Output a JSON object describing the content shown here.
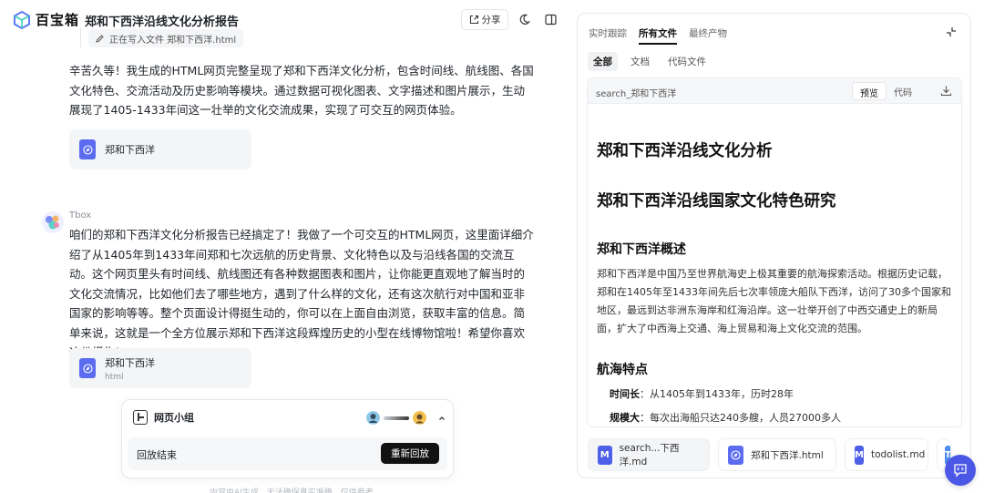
{
  "app": {
    "name": "百宝箱",
    "doc_title": "郑和下西洋沿线文化分析报告"
  },
  "header": {
    "share_label": "分享"
  },
  "chat": {
    "writing_chip": "正在写入文件  郑和下西洋.html",
    "msg1": "辛苦久等！我生成的HTML网页完整呈现了郑和下西洋文化分析，包含时间线、航线图、各国文化特色、交流活动及历史影响等模块。通过数据可视化图表、文字描述和图片展示，生动展现了1405-1433年间这一壮举的文化交流成果，实现了可交互的网页体验。",
    "card1_name": "郑和下西洋",
    "sender": "Tbox",
    "msg2": "咱们的郑和下西洋文化分析报告已经搞定了！我做了一个可交互的HTML网页，这里面详细介绍了从1405年到1433年间郑和七次远航的历史背景、文化特色以及与沿线各国的交流互动。这个网页里头有时间线、航线图还有各种数据图表和图片，让你能更直观地了解当时的文化交流情况，比如他们去了哪些地方，遇到了什么样的文化，还有这次航行对中国和亚非国家的影响等等。整个页面设计得挺生动的，你可以在上面自由浏览，获取丰富的信息。简单来说，这就是一个全方位展示郑和下西洋这段辉煌历史的小型在线博物馆啦！希望你喜欢这份报告！",
    "card2_name": "郑和下西洋",
    "card2_sub": "html"
  },
  "replay": {
    "group_label": "网页小组",
    "status": "回放结束",
    "replay_button": "重新回放",
    "progress": 1.0
  },
  "disclaimer": "内容由AI生成，无法确保真实准确，仅供参考",
  "panel": {
    "tabs": [
      "实时跟踪",
      "所有文件",
      "最终产物"
    ],
    "active_tab": "所有文件",
    "subtabs": [
      "全部",
      "文档",
      "代码文件"
    ],
    "active_subtab": "全部",
    "viewer_name": "search_郑和下西洋",
    "view_modes": [
      "预览",
      "代码"
    ],
    "doc": {
      "h1a": "郑和下西洋沿线文化分析",
      "h1b": "郑和下西洋沿线国家文化特色研究",
      "h2a": "郑和下西洋概述",
      "p1": "郑和下西洋是中国乃至世界航海史上极其重要的航海探索活动。根据历史记载，郑和在1405年至1433年间先后七次率领庞大船队下西洋，访问了30多个国家和地区，最远到达非洲东海岸和红海沿岸。这一壮举开创了中西交通史上的新局面，扩大了中西海上交通、海上贸易和海上文化交流的范围。",
      "h2b": "航海特点",
      "li1_k": "时间长",
      "li1_v": "：从1405年到1433年，历时28年",
      "li2_k": "规模大",
      "li2_v": "：每次出海船只达240多艘，人员27000多人"
    },
    "files": [
      {
        "name": "search...下西洋.md",
        "icon": "M"
      },
      {
        "name": "郑和下西洋.html",
        "icon": "compass"
      },
      {
        "name": "todolist.md",
        "icon": "M"
      },
      {
        "name": "",
        "icon": "T"
      }
    ]
  },
  "colors": {
    "accent": "#4b58e6",
    "file_icon": "#5b6cf0"
  }
}
